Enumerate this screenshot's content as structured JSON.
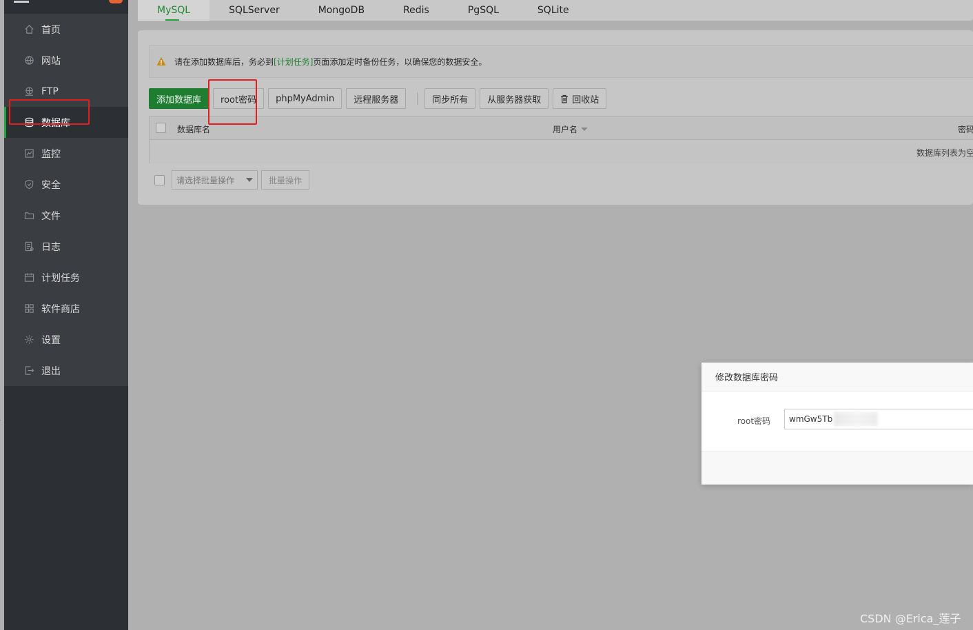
{
  "sidebar": {
    "items": [
      {
        "label": "首页",
        "icon": "home-icon"
      },
      {
        "label": "网站",
        "icon": "globe-icon"
      },
      {
        "label": "FTP",
        "icon": "ftp-icon"
      },
      {
        "label": "数据库",
        "icon": "database-icon"
      },
      {
        "label": "监控",
        "icon": "monitor-icon"
      },
      {
        "label": "安全",
        "icon": "shield-icon"
      },
      {
        "label": "文件",
        "icon": "folder-icon"
      },
      {
        "label": "日志",
        "icon": "log-icon"
      },
      {
        "label": "计划任务",
        "icon": "calendar-icon"
      },
      {
        "label": "软件商店",
        "icon": "grid-icon"
      },
      {
        "label": "设置",
        "icon": "gear-icon"
      },
      {
        "label": "退出",
        "icon": "logout-icon"
      }
    ],
    "active_index": 3
  },
  "tabs": [
    "MySQL",
    "SQLServer",
    "MongoDB",
    "Redis",
    "PgSQL",
    "SQLite"
  ],
  "alert": {
    "prefix": "请在添加数据库后，务必到",
    "link": "[计划任务]",
    "suffix": "页面添加定时备份任务，以确保您的数据安全。"
  },
  "toolbar": {
    "add_db": "添加数据库",
    "root_password": "root密码",
    "phpmyadmin": "phpMyAdmin",
    "remote_server": "远程服务器",
    "sync_all": "同步所有",
    "fetch_from_server": "从服务器获取",
    "recycle_bin": "回收站"
  },
  "table": {
    "col_name": "数据库名",
    "col_user": "用户名",
    "col_password": "密码",
    "empty": "数据库列表为空"
  },
  "batch": {
    "select_placeholder": "请选择批量操作",
    "button": "批量操作"
  },
  "dialog": {
    "title": "修改数据库密码",
    "label": "root密码",
    "value": "wmGw5Tb"
  },
  "watermark": "CSDN @Erica_莲子",
  "colors": {
    "accent": "#20a53a",
    "highlight": "#e02020",
    "sidebar_bg": "#3a3d41"
  }
}
